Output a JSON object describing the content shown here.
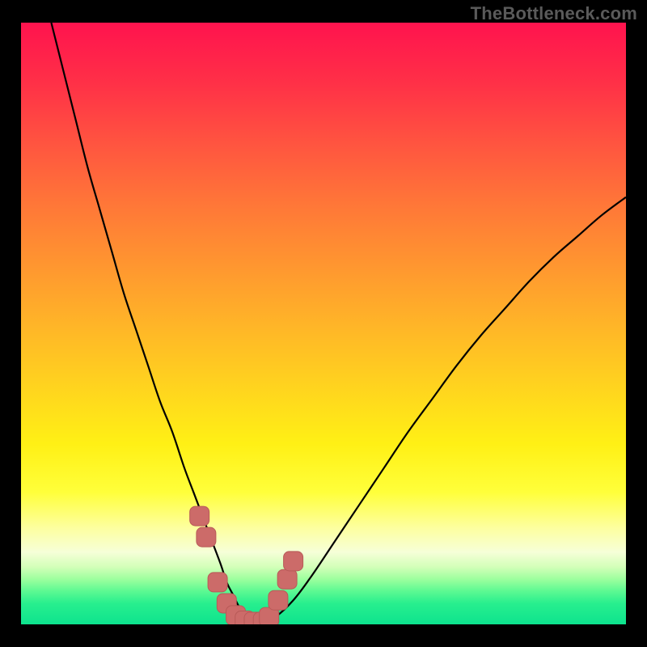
{
  "watermark": "TheBottleneck.com",
  "colors": {
    "frame": "#000000",
    "curve": "#000000",
    "marker_fill": "#cc6b69",
    "marker_stroke": "#b85a58",
    "gradient_stops": [
      {
        "offset": 0.0,
        "color": "#ff134e"
      },
      {
        "offset": 0.1,
        "color": "#ff3047"
      },
      {
        "offset": 0.2,
        "color": "#ff5440"
      },
      {
        "offset": 0.3,
        "color": "#ff7638"
      },
      {
        "offset": 0.4,
        "color": "#ff9530"
      },
      {
        "offset": 0.5,
        "color": "#ffb428"
      },
      {
        "offset": 0.6,
        "color": "#ffd21f"
      },
      {
        "offset": 0.7,
        "color": "#fff015"
      },
      {
        "offset": 0.78,
        "color": "#ffff3a"
      },
      {
        "offset": 0.84,
        "color": "#fdffa0"
      },
      {
        "offset": 0.88,
        "color": "#f6ffd8"
      },
      {
        "offset": 0.905,
        "color": "#d2ffb8"
      },
      {
        "offset": 0.925,
        "color": "#9cff9e"
      },
      {
        "offset": 0.945,
        "color": "#5cf992"
      },
      {
        "offset": 0.965,
        "color": "#28ef8e"
      },
      {
        "offset": 1.0,
        "color": "#0de38e"
      }
    ]
  },
  "chart_data": {
    "type": "line",
    "title": "",
    "xlabel": "",
    "ylabel": "",
    "xlim": [
      0,
      100
    ],
    "ylim": [
      0,
      100
    ],
    "x": [
      5,
      7,
      9,
      11,
      13,
      15,
      17,
      19,
      21,
      23,
      25,
      27,
      28.5,
      30,
      31.5,
      33,
      34,
      35,
      36,
      37,
      38,
      40,
      42,
      45,
      48,
      52,
      56,
      60,
      64,
      68,
      72,
      76,
      80,
      84,
      88,
      92,
      96,
      100
    ],
    "y": [
      100,
      92,
      84,
      76,
      69,
      62,
      55,
      49,
      43,
      37,
      32,
      26,
      22,
      18,
      14,
      10,
      7,
      5,
      3,
      1.5,
      0.5,
      0.5,
      1.2,
      4,
      8,
      14,
      20,
      26,
      32,
      37.5,
      43,
      48,
      52.5,
      57,
      61,
      64.5,
      68,
      71
    ],
    "markers": {
      "x": [
        29.5,
        30.6,
        32.5,
        34.0,
        35.5,
        37.0,
        38.5,
        40.0,
        41.0,
        42.5,
        44.0,
        45.0
      ],
      "y": [
        18.0,
        14.5,
        7.0,
        3.5,
        1.5,
        0.6,
        0.4,
        0.4,
        1.2,
        4.0,
        7.5,
        10.5
      ]
    }
  }
}
